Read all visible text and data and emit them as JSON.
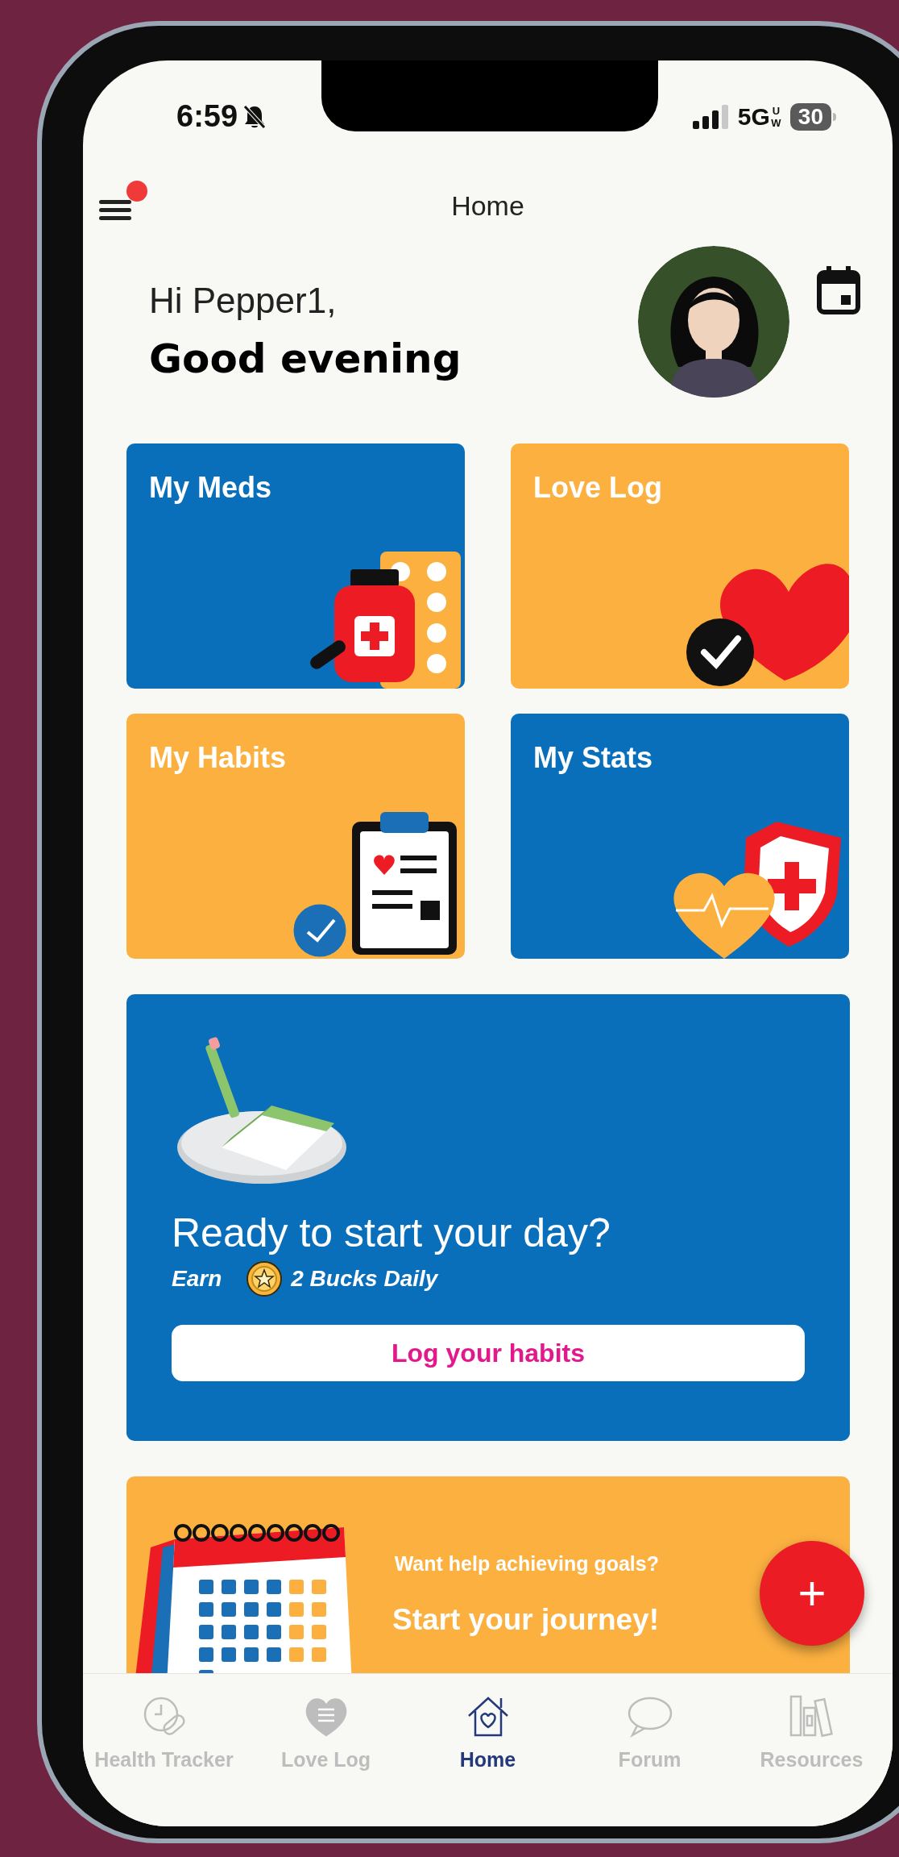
{
  "status_bar": {
    "time": "6:59",
    "network": "5G",
    "network_suffix": "UW",
    "battery": "30"
  },
  "header": {
    "title": "Home",
    "menu_badge": true
  },
  "greeting": {
    "line_1": "Hi Pepper1,",
    "line_2": "Good evening"
  },
  "tiles": [
    {
      "title": "My Meds",
      "color": "#0a6fba",
      "kind": "meds"
    },
    {
      "title": "Love Log",
      "color": "#fbb040",
      "kind": "love"
    },
    {
      "title": "My Habits",
      "color": "#fbb040",
      "kind": "habits"
    },
    {
      "title": "My Stats",
      "color": "#0a6fba",
      "kind": "stats"
    }
  ],
  "promo": {
    "title": "Ready to start your day?",
    "earn_label": "Earn",
    "reward": "2 Bucks Daily",
    "button": "Log your habits"
  },
  "journey": {
    "subtitle": "Want help achieving goals?",
    "title": "Start your journey!"
  },
  "fab": {
    "label": "+"
  },
  "nav": [
    {
      "label": "Health Tracker",
      "kind": "tracker",
      "selected": false
    },
    {
      "label": "Love Log",
      "kind": "love",
      "selected": false
    },
    {
      "label": "Home",
      "kind": "home",
      "selected": true
    },
    {
      "label": "Forum",
      "kind": "forum",
      "selected": false
    },
    {
      "label": "Resources",
      "kind": "resources",
      "selected": false
    }
  ]
}
